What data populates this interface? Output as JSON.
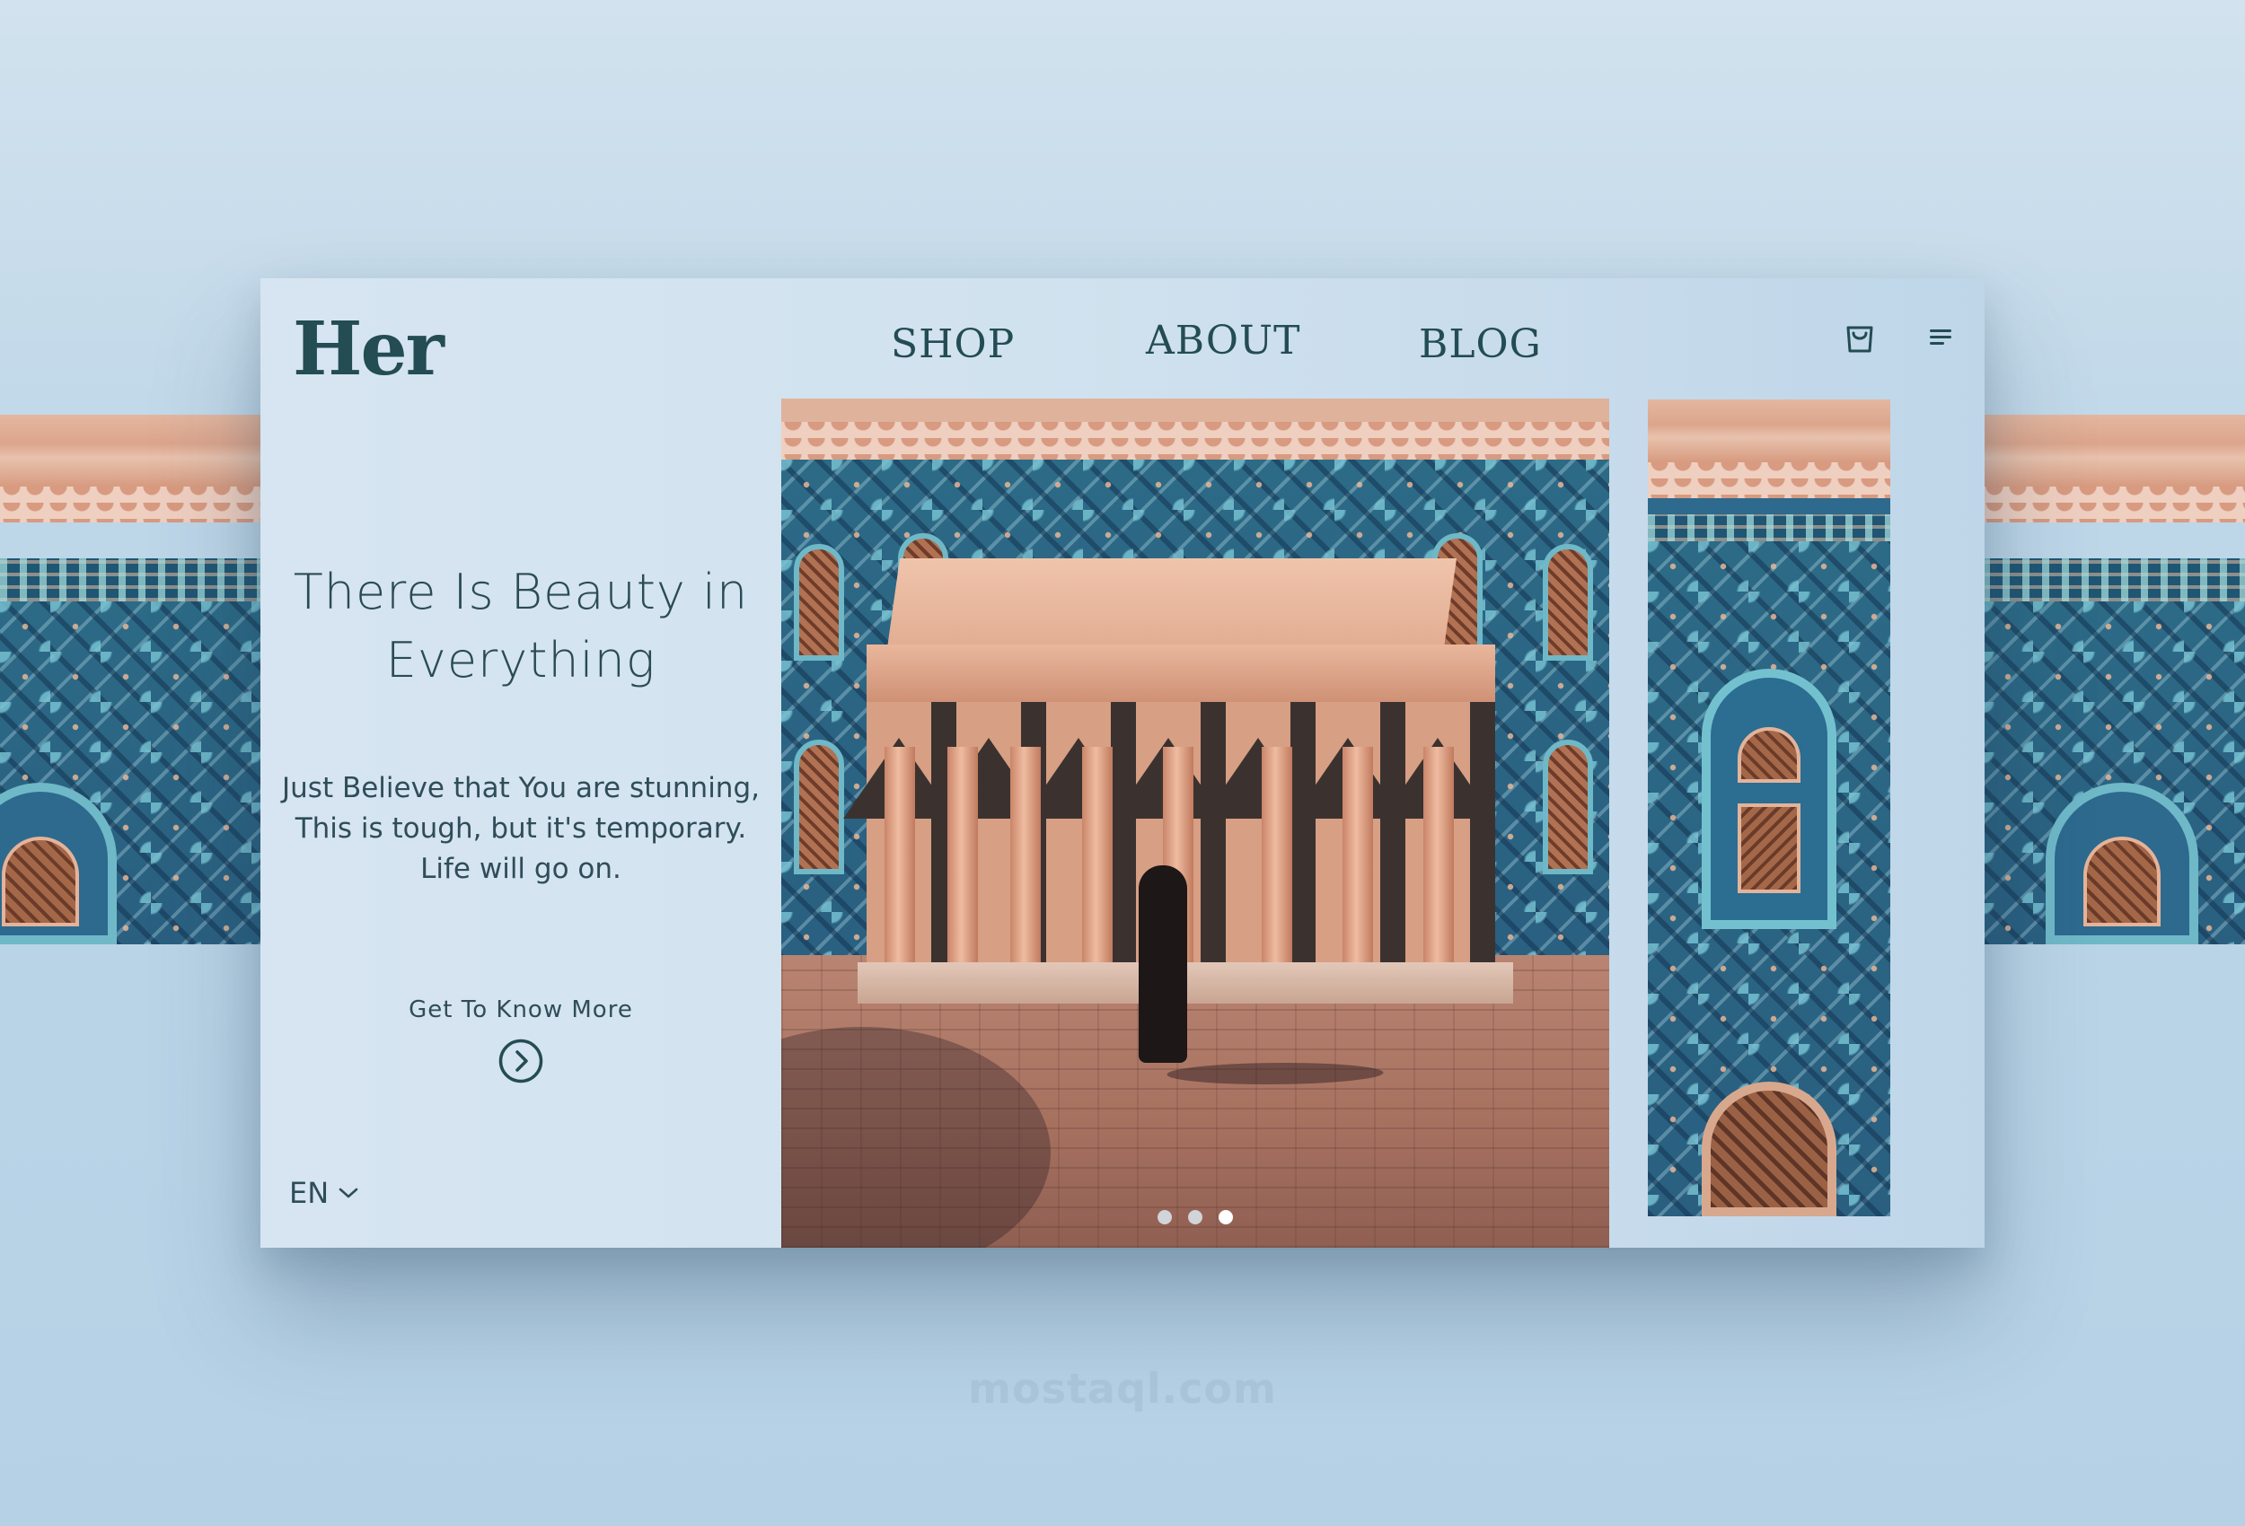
{
  "brand": {
    "logo": "Her"
  },
  "nav": {
    "items": [
      {
        "label": "SHOP"
      },
      {
        "label": "ABOUT"
      },
      {
        "label": "BLOG"
      }
    ]
  },
  "header_icons": {
    "cart": "shopping-bag-icon",
    "menu": "hamburger-menu-icon"
  },
  "hero": {
    "headline_line1": "There Is Beauty in",
    "headline_line2": "Everything",
    "sub_line1": "Just Believe that You are stunning,",
    "sub_line2": "This is tough, but it's temporary.",
    "sub_line3": "Life will go on.",
    "cta_label": "Get To Know More",
    "cta_icon": "chevron-right-circle-icon"
  },
  "language": {
    "selected": "EN",
    "icon": "chevron-down-icon"
  },
  "carousel": {
    "slide_count": 3,
    "active_index": 2
  },
  "watermark": {
    "text": "mostaql.com"
  },
  "colors": {
    "brand_dark": "#234c53",
    "card_bg": "#d6e5f1",
    "page_bg": "#bdd6e8"
  }
}
